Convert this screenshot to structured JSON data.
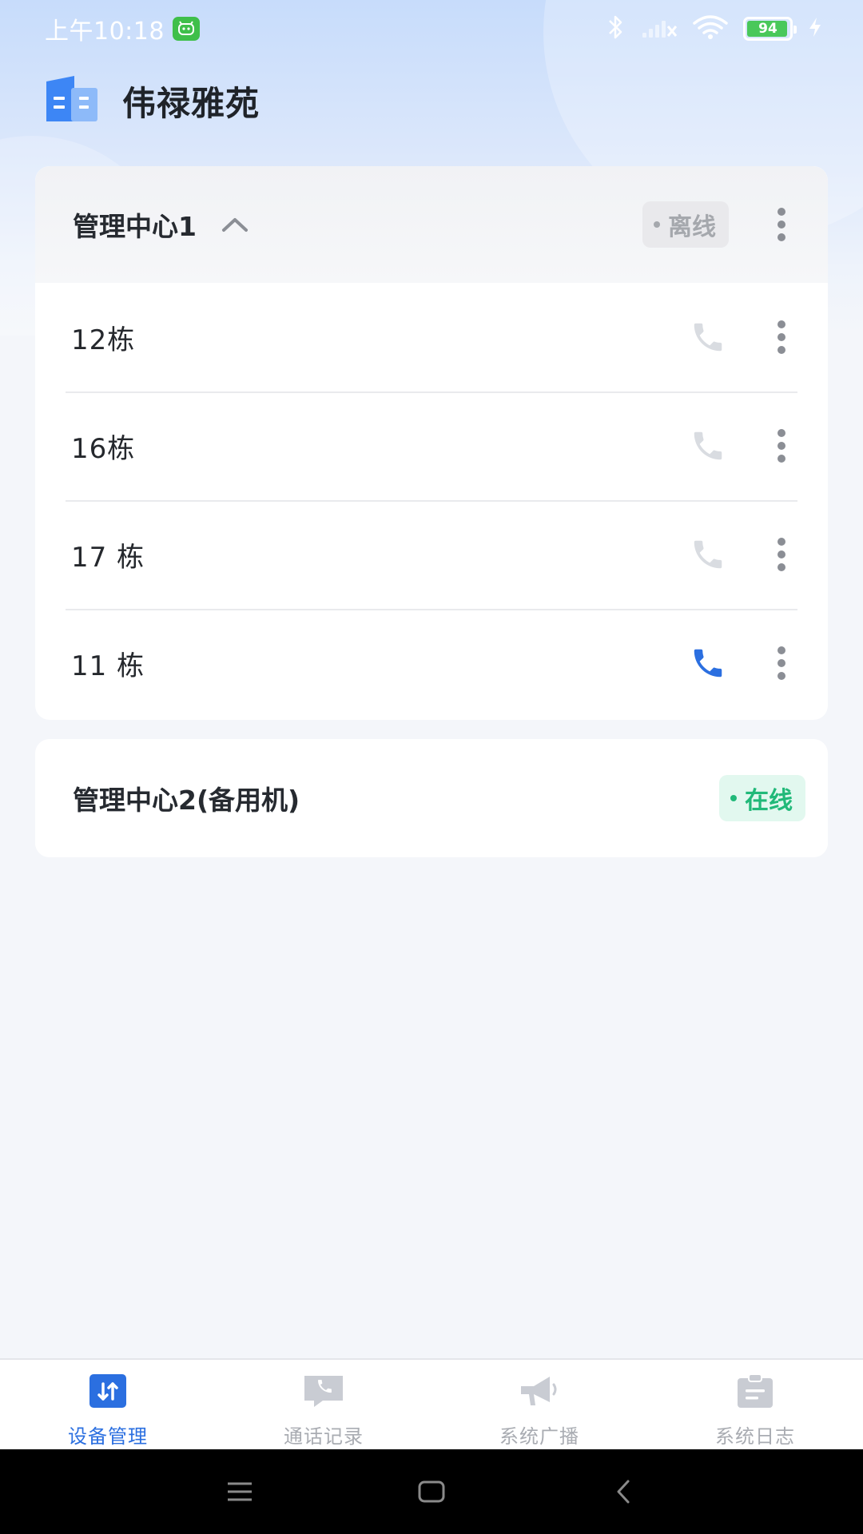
{
  "status_bar": {
    "time": "上午10:18",
    "battery": "94"
  },
  "header": {
    "title": "伟禄雅苑"
  },
  "groups": [
    {
      "title": "管理中心1",
      "status": "离线",
      "expanded": true,
      "items": [
        {
          "label": "12栋",
          "call_active": false
        },
        {
          "label": "16栋",
          "call_active": false
        },
        {
          "label": "17 栋",
          "call_active": false
        },
        {
          "label": "11 栋",
          "call_active": true
        }
      ]
    },
    {
      "title": "管理中心2(备用机)",
      "status": "在线"
    }
  ],
  "bottom_nav": [
    {
      "label": "设备管理",
      "icon": "device-manage-icon",
      "active": true
    },
    {
      "label": "通话记录",
      "icon": "call-record-icon",
      "active": false
    },
    {
      "label": "系统广播",
      "icon": "megaphone-icon",
      "active": false
    },
    {
      "label": "系统日志",
      "icon": "log-clipboard-icon",
      "active": false
    }
  ],
  "colors": {
    "accent": "#2b6fe0",
    "offline": "#a5a8ad",
    "online": "#21b979",
    "call_inactive": "#d9dce1"
  }
}
